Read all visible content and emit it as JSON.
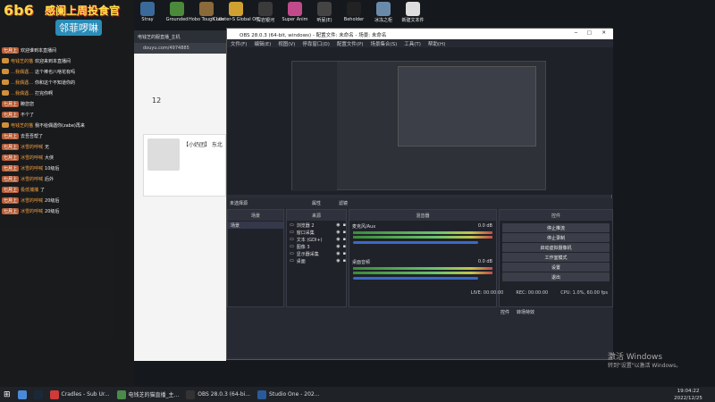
{
  "overlay": {
    "logo": "6b6",
    "title": "感阑上周投食官",
    "fan_name": "邻菲啰啉"
  },
  "desktop_icons": [
    {
      "label": "Stray",
      "color": "#3a6a9a"
    },
    {
      "label": "Grounded",
      "color": "#4a8a3a"
    },
    {
      "label": "Hobo Tough Life",
      "color": "#8a6a3a"
    },
    {
      "label": "Counter-S Global Off",
      "color": "#d0a030"
    },
    {
      "label": "深岩银河",
      "color": "#3a3a3a"
    },
    {
      "label": "Super Anim",
      "color": "#c04a8a"
    },
    {
      "label": "听屁(E)",
      "color": "#444"
    },
    {
      "label": "Beholder",
      "color": "#222"
    },
    {
      "label": "冰冻之柜",
      "color": "#6a8aaa"
    },
    {
      "label": "新建文本件",
      "color": "#ddd"
    }
  ],
  "chat": [
    {
      "badge": "七月上",
      "name": "",
      "text": "欢迎谁到本直播间"
    },
    {
      "badge": "",
      "name": "电钱芝的猫",
      "text": "欢迎来到本直播间"
    },
    {
      "badge": "",
      "name": "…我偶遇…",
      "text": "这个棒也八啥花有吗"
    },
    {
      "badge": "",
      "name": "…我偶遇…",
      "text": "你和这个不知道你的"
    },
    {
      "badge": "",
      "name": "…我偶遇…",
      "text": "打完你啊"
    },
    {
      "badge": "七月上",
      "name": "",
      "text": "瞭您您"
    },
    {
      "badge": "七月上",
      "name": "",
      "text": "不个了"
    },
    {
      "badge": "",
      "name": "电钱芝的猫",
      "text": "我不给偶遇你(zabe)再来"
    },
    {
      "badge": "七月上",
      "name": "",
      "text": "去吾吾帮了"
    },
    {
      "badge": "七月上",
      "name": "冰雪的呼喊",
      "text": "无"
    },
    {
      "badge": "七月上",
      "name": "冰雪的呼喊",
      "text": "大侠"
    },
    {
      "badge": "七月上",
      "name": "冰雪的呼喊",
      "text": "10级后"
    },
    {
      "badge": "七月上",
      "name": "冰雪的呼喊",
      "text": "后外"
    },
    {
      "badge": "七月上",
      "name": "极低捕捕",
      "text": "了"
    },
    {
      "badge": "七月上",
      "name": "冰雪的呼喊",
      "text": "20级后"
    },
    {
      "badge": "七月上",
      "name": "冰雪的呼喊",
      "text": "20级后"
    }
  ],
  "browser": {
    "tab": "电钱芝的服直播_主机",
    "url": "douyu.com/4974885",
    "room_count": "12",
    "room_title": "【小奶团】 东北"
  },
  "obs": {
    "title": "OBS 28.0.3 (64-bit, windows) - 配置文件: 未命名 - 场景: 未命名",
    "menu": [
      "文件(F)",
      "编辑(E)",
      "视图(V)",
      "停靠窗口(D)",
      "配置文件(P)",
      "场景集合(S)",
      "工具(T)",
      "帮助(H)"
    ],
    "no_source": "未选择源",
    "props_btn": "属性",
    "filter_btn": "滤镜",
    "panels": {
      "scenes": "场景",
      "sources": "来源",
      "mixer": "混音器",
      "controls": "控件"
    },
    "scene_items": [
      "场景"
    ],
    "source_items": [
      "浏览器 2",
      "窗口采集",
      "文本 (GDI+)",
      "图像 3",
      "显示器采集",
      "桌面"
    ],
    "mixer_items": [
      {
        "name": "麦克风/Aux",
        "level": "0.0 dB"
      },
      {
        "name": "桌面音频",
        "level": "0.0 dB"
      }
    ],
    "controls": [
      "停止推流",
      "停止录制",
      "启动虚拟摄像机",
      "工作室模式",
      "设置",
      "退出"
    ],
    "bottom_tabs": [
      "控件",
      "转场特效"
    ],
    "status": {
      "live": "LIVE: 00:00:00",
      "rec": "REC: 00:00:00",
      "cpu": "CPU: 1.0%, 60.00 fps"
    }
  },
  "activation": {
    "line1": "激活 Windows",
    "line2": "转到\"设置\"以激活 Windows。"
  },
  "taskbar": {
    "items": [
      {
        "label": "",
        "color": "#4a8ad8"
      },
      {
        "label": "",
        "color": "#1b2838"
      },
      {
        "label": "Cradles - Sub Ur...",
        "color": "#d03a3a"
      },
      {
        "label": "电钱芝的猫直播_主...",
        "color": "#4a8a4a"
      },
      {
        "label": "OBS 28.0.3 (64-bi...",
        "color": "#333"
      },
      {
        "label": "Studio One - 202...",
        "color": "#2a5a9a"
      }
    ],
    "time": "19:04:22",
    "date": "2022/12/25"
  }
}
